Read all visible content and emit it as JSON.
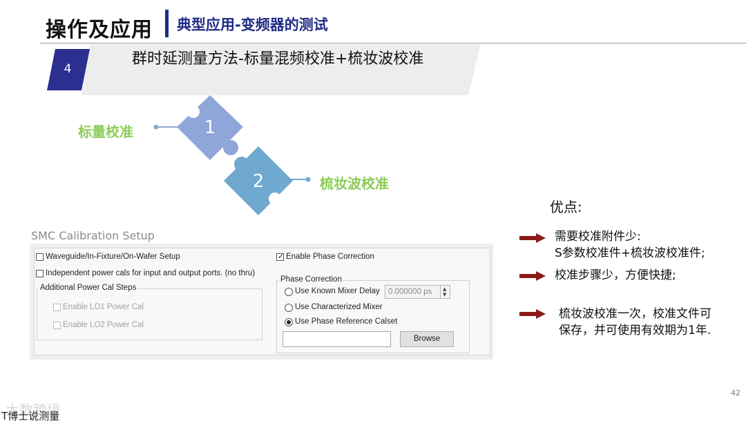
{
  "header": {
    "title": "操作及应用",
    "subtitle": "典型应用-变频器的测试"
  },
  "banner": {
    "step_number": "4",
    "text": "群时延测量方法-标量混频校准+梳妆波校准",
    "accent_color": "#2b2f8f"
  },
  "puzzle": {
    "piece1": {
      "number": "1",
      "label": "标量校准",
      "color": "#8fa6d8"
    },
    "piece2": {
      "number": "2",
      "label": "梳妆波校准",
      "color": "#6fa9cf"
    },
    "label_color": "#8ccc58"
  },
  "advantages": {
    "title": "优点:",
    "arrow_color": "#8b1a1a",
    "items": [
      {
        "line1": "需要校准附件少:",
        "line2": "S参数校准件+梳妆波校准件;"
      },
      {
        "line1": "校准步骤少，方便快捷;",
        "line2": ""
      },
      {
        "line1": "梳妆波校准一次，校准文件可",
        "line2": "保存，并可使用有效期为1年."
      }
    ]
  },
  "dialog": {
    "title": "SMC Calibration Setup",
    "waveguide_label": "Waveguide/In-Fixture/On-Wafer Setup",
    "waveguide_checked": false,
    "independent_label": "Independent power cals for input and output ports. (no thru)",
    "independent_checked": false,
    "additional_group": "Additional Power Cal Steps",
    "lo1_label": "Enable LO1 Power Cal",
    "lo1_checked": false,
    "lo2_label": "Enable LO2 Power Cal",
    "lo2_checked": false,
    "phase_correction_label": "Enable Phase Correction",
    "phase_correction_checked": true,
    "phase_group": "Phase Correction",
    "radio_options": [
      {
        "label": "Use Known Mixer Delay",
        "selected": false
      },
      {
        "label": "Use Characterized Mixer",
        "selected": false
      },
      {
        "label": "Use Phase Reference Calset",
        "selected": true
      }
    ],
    "delay_value": "0.000000 ps",
    "calset_value": "",
    "browse_label": "Browse"
  },
  "page_number": "42",
  "watermark": {
    "text": "大数跨境",
    "caption": "T博士说测量"
  }
}
